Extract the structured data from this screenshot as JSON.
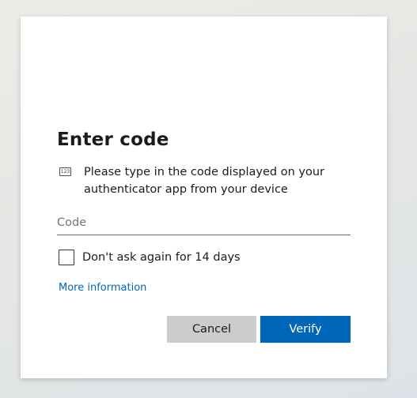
{
  "dialog": {
    "title": "Enter code",
    "instruction": "Please type in the code displayed on your authenticator app from your device",
    "instruction_icon": "numeric-keypad-icon",
    "instruction_icon_text": "123",
    "code_input": {
      "placeholder": "Code",
      "value": ""
    },
    "remember_checkbox": {
      "label": "Don't ask again for 14 days",
      "checked": false
    },
    "more_info_link": "More information",
    "buttons": {
      "cancel": "Cancel",
      "verify": "Verify"
    }
  },
  "colors": {
    "accent": "#0067b8",
    "cancel_bg": "#cccccc",
    "text": "#1b1b1b"
  }
}
